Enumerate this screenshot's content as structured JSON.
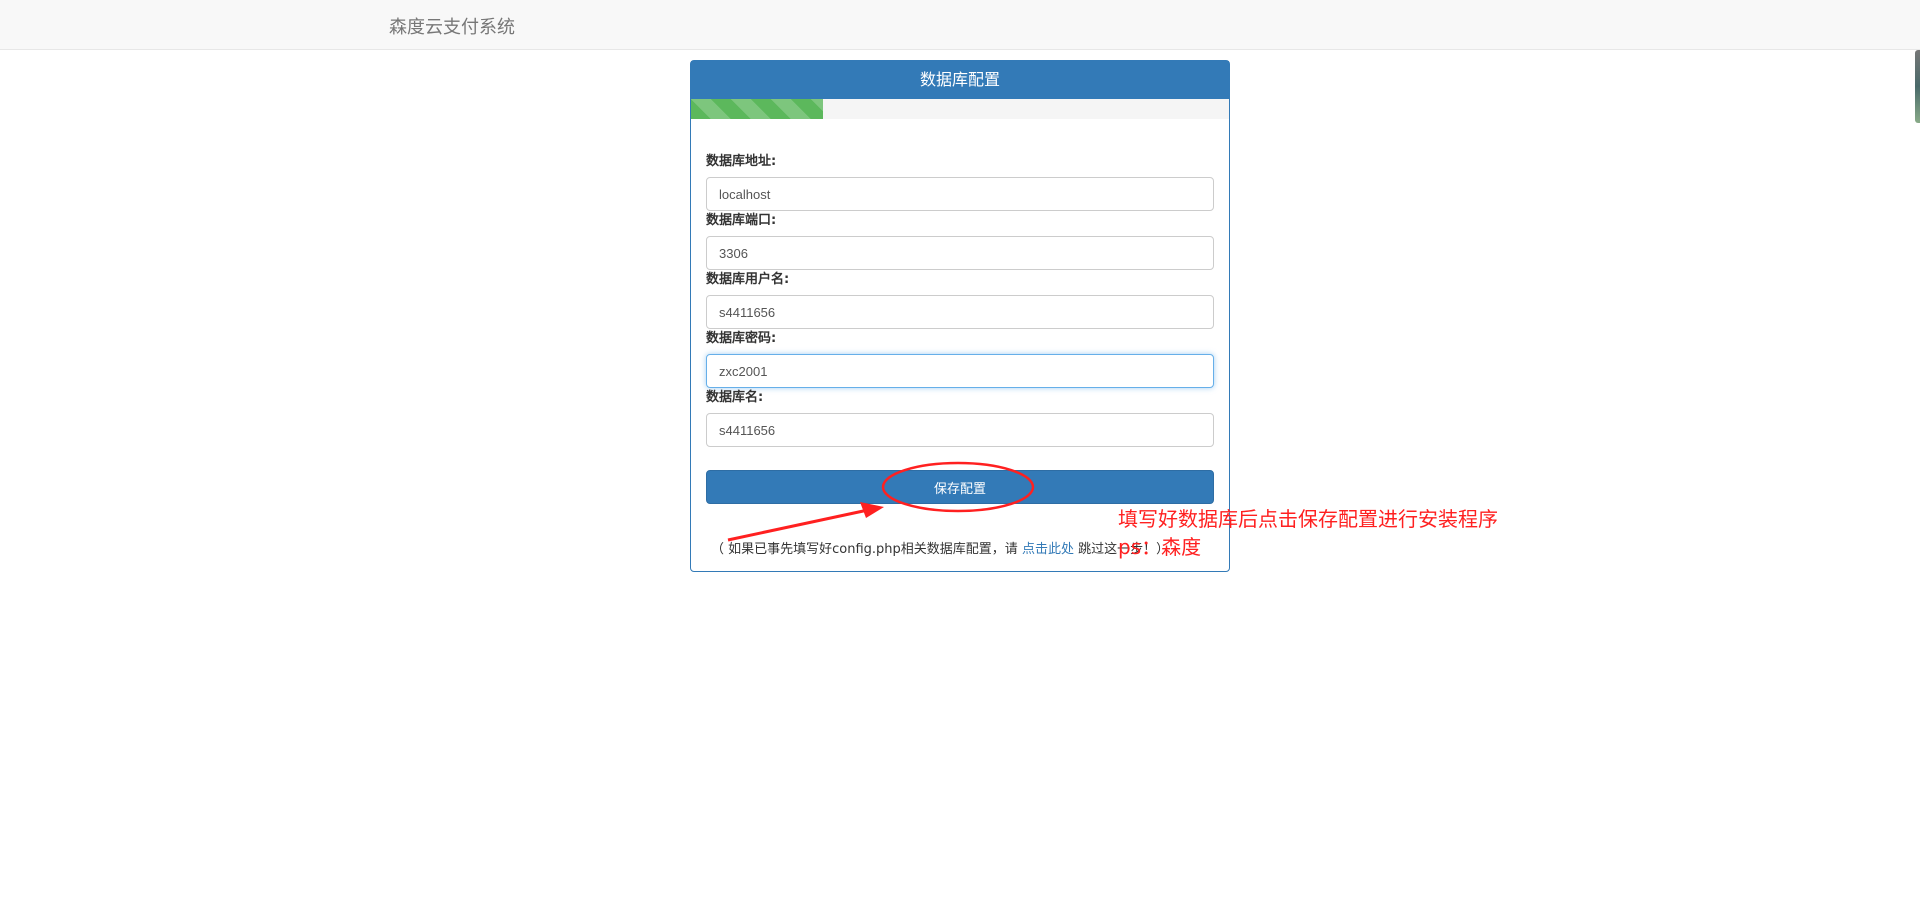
{
  "header": {
    "brand": "森度云支付系统"
  },
  "panel": {
    "title": "数据库配置",
    "progress_fraction": 0.245,
    "progress_color": "#5cb85c",
    "accent_color": "#337ab7"
  },
  "form": {
    "fields": [
      {
        "label": "数据库地址:",
        "value": "localhost"
      },
      {
        "label": "数据库端口:",
        "value": "3306"
      },
      {
        "label": "数据库用户名:",
        "value": "s4411656"
      },
      {
        "label": "数据库密码:",
        "value": "zxc2001"
      },
      {
        "label": "数据库名:",
        "value": "s4411656"
      }
    ],
    "save_label": "保存配置"
  },
  "note": {
    "prefix": "（ 如果已事先填写好config.php相关数据库配置，请",
    "link": "点击此处",
    "suffix": "跳过这一步！）"
  },
  "annotations": {
    "line1": "填写好数据库后点击保存配置进行安装程序",
    "line2": "ps：森度",
    "color": "#ff2020"
  }
}
